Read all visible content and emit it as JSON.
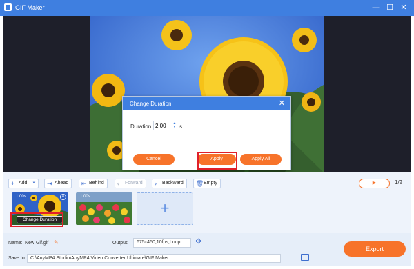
{
  "window": {
    "title": "GIF Maker",
    "minimize": "—",
    "maximize": "☐",
    "close": "✕"
  },
  "dialog": {
    "title": "Change Duration",
    "close": "✕",
    "duration_label": "Duration:",
    "duration_value": "2.00",
    "unit": "s",
    "cancel": "Cancel",
    "apply": "Apply",
    "apply_all": "Apply All"
  },
  "toolbar": {
    "add": "Add",
    "add_icon": "+",
    "ahead": "Ahead",
    "behind": "Behind",
    "forward": "Forward",
    "backward": "Backward",
    "empty": "Empty",
    "play_icon": "▶",
    "page": "1/2"
  },
  "clips": [
    {
      "duration": "1.00s",
      "change_label": "Change Duration"
    },
    {
      "duration": "1.00s"
    }
  ],
  "add_tile": "+",
  "bottom": {
    "name_label": "Name:",
    "name_value": "New Gif.gif",
    "output_label": "Output:",
    "output_value": "675x450;10fps;Loop",
    "save_label": "Save to:",
    "save_path": "C:\\AnyMP4 Studio\\AnyMP4 Video Converter Ultimate\\GIF Maker",
    "more": "···",
    "export": "Export"
  },
  "colors": {
    "accent": "#3f7fe0",
    "orange": "#f7732a",
    "highlight": "#e0202a"
  }
}
